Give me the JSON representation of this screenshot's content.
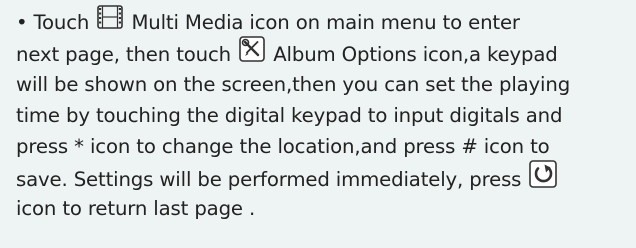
{
  "instruction": {
    "bullet": "•",
    "line1": {
      "before": "Touch",
      "icon": "film-icon",
      "after": "Multi Media icon on main menu to enter"
    },
    "line2": {
      "before": "next page, then touch",
      "icon": "wrench-screwdriver-icon",
      "after": "Album Options icon,a keypad"
    },
    "line3": "will be shown on the screen,then you can set the playing",
    "line4": "time by touching the digital keypad to input digitals and",
    "line5": "press * icon to change the location,and press # icon to",
    "line6": {
      "before": "save. Settings will be performed immediately, press",
      "icon": "return-arrow-icon"
    },
    "line7": "icon to return last page ."
  }
}
